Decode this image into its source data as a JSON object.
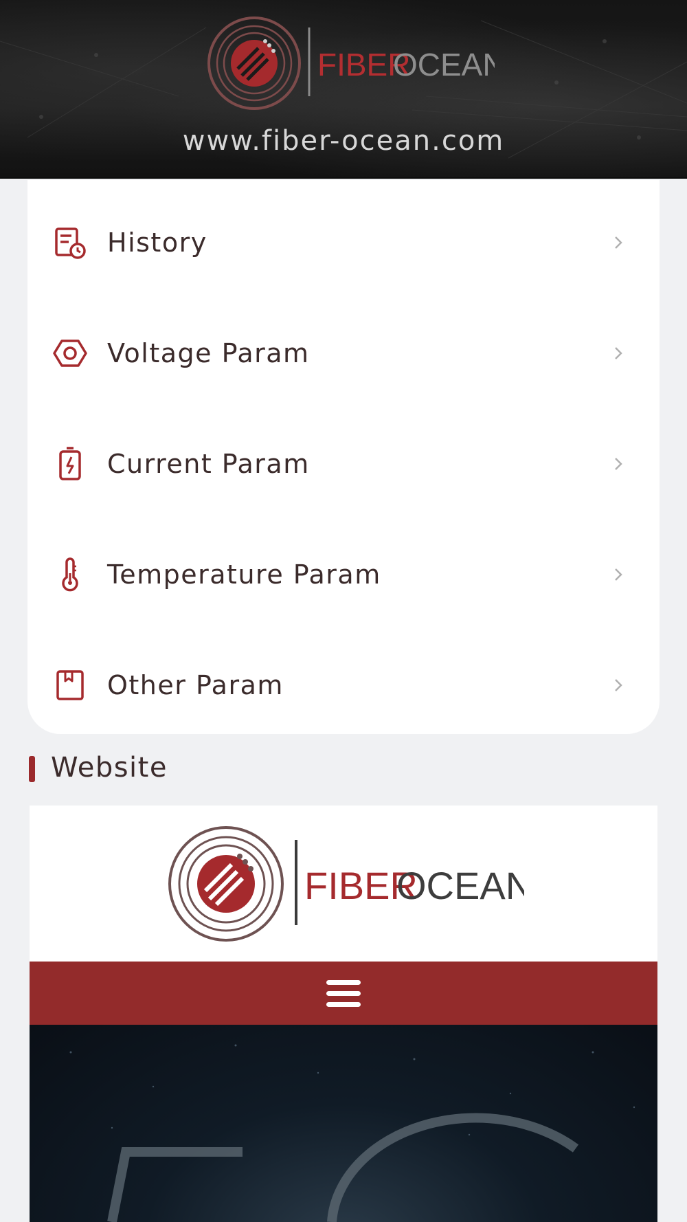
{
  "header": {
    "brand_primary": "FIBER",
    "brand_secondary": "OCEAN",
    "url": "www.fiber-ocean.com"
  },
  "menu": {
    "items": [
      {
        "label": "History",
        "icon": "history-icon"
      },
      {
        "label": "Voltage Param",
        "icon": "hexagon-nut-icon"
      },
      {
        "label": "Current Param",
        "icon": "battery-bolt-icon"
      },
      {
        "label": "Temperature Param",
        "icon": "thermometer-icon"
      },
      {
        "label": "Other Param",
        "icon": "bookmark-book-icon"
      }
    ]
  },
  "website_section": {
    "title": "Website",
    "brand_primary": "FIBER",
    "brand_secondary": "OCEAN"
  },
  "colors": {
    "accent": "#932b2b",
    "icon": "#a52a2d",
    "chevron": "#b0b0b0",
    "text": "#3b2b2b"
  }
}
